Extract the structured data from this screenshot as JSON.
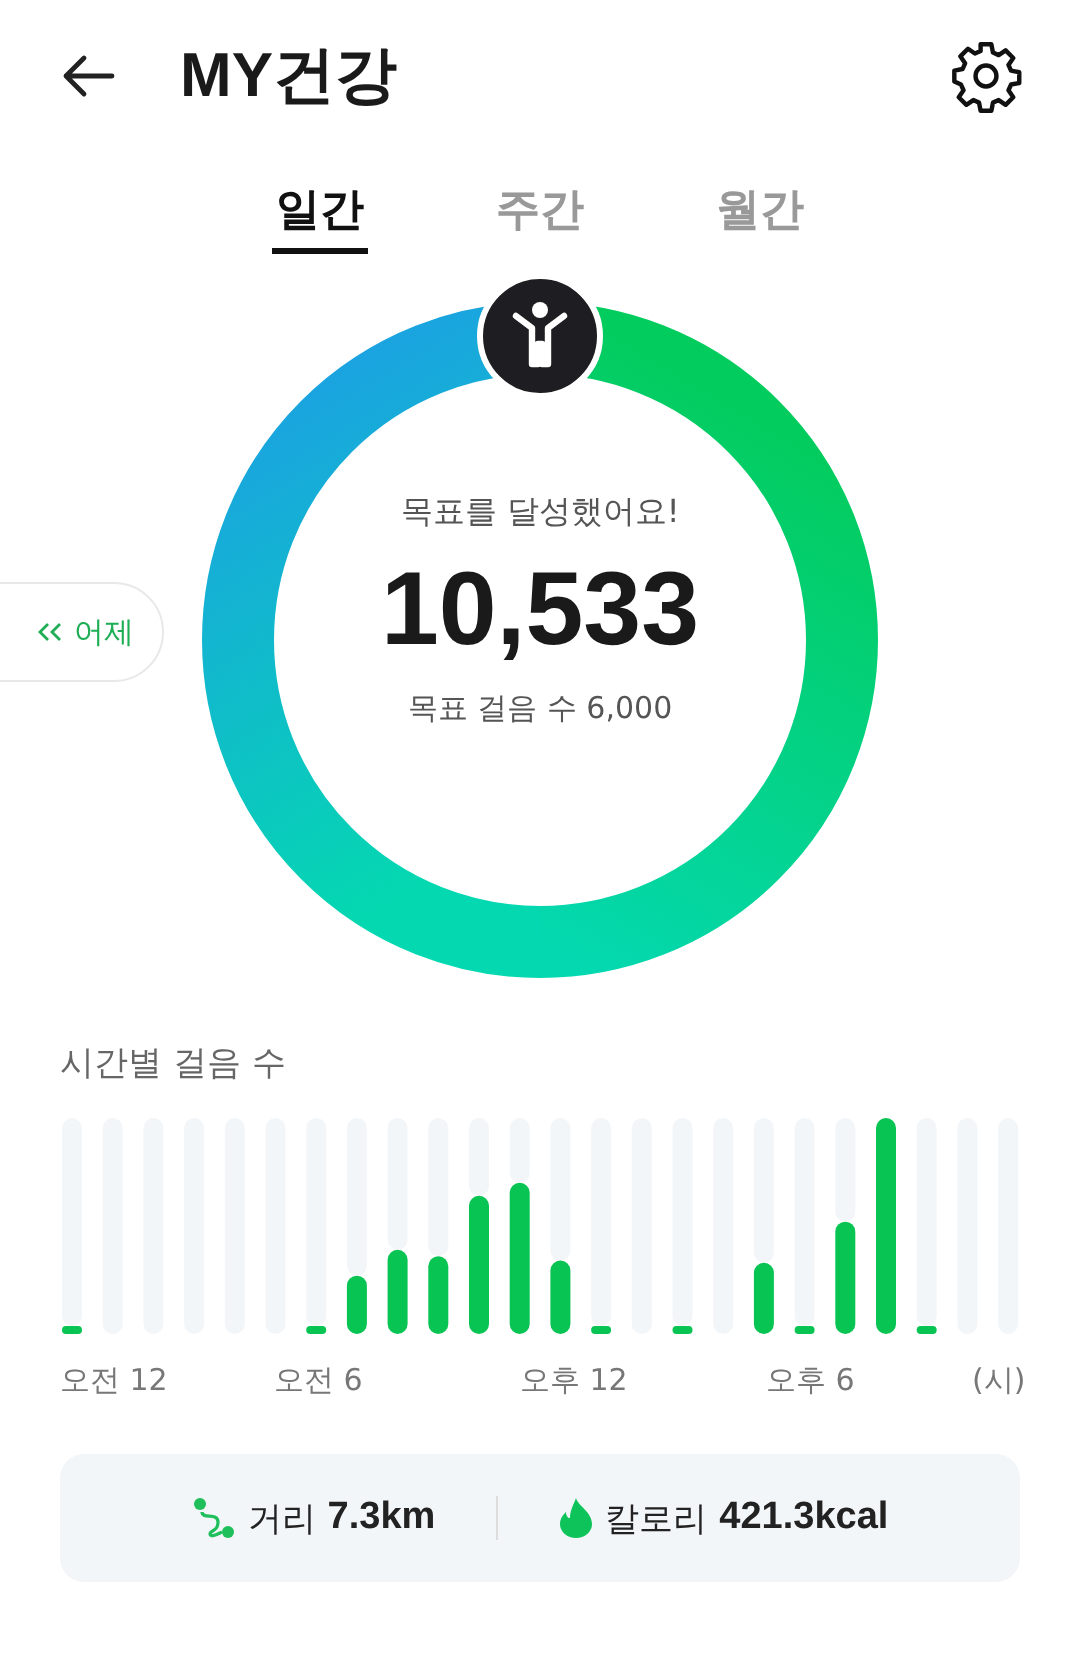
{
  "header": {
    "title": "MY건강"
  },
  "tabs": [
    {
      "label": "일간",
      "selected": true
    },
    {
      "label": "주간",
      "selected": false
    },
    {
      "label": "월간",
      "selected": false
    }
  ],
  "summary": {
    "message": "목표를 달성했어요!",
    "steps": "10,533",
    "goal": "목표 걸음 수 6,000",
    "previous_button": "어제"
  },
  "hourly": {
    "title": "시간별 걸음 수",
    "axis_labels": [
      "오전 12",
      "오전 6",
      "오후 12",
      "오후 6",
      "(시)"
    ]
  },
  "stats": [
    {
      "kind": "distance",
      "label": "거리",
      "value": "7.3km"
    },
    {
      "kind": "calories",
      "label": "칼로리",
      "value": "421.3kcal"
    }
  ]
}
